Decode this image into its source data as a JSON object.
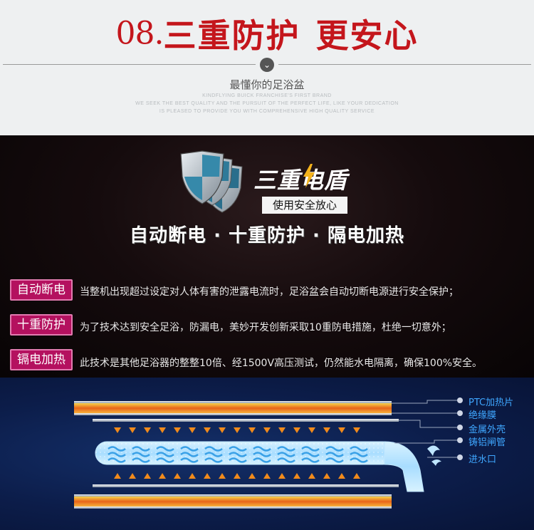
{
  "header": {
    "num": "08.",
    "title_a": "三重防护",
    "title_b": "更安心",
    "subtitle": "最懂你的足浴盆",
    "en_line1": "KINDFLYING Buick franchise's first brand",
    "en_line2": "We seek the best quality and the pursuit of the perfect life, like your dedication",
    "en_line3": "Is pleased to provide you with comprehensive high quality service"
  },
  "brand": {
    "title": "三重电盾",
    "sub": "使用安全放心",
    "slogan": "自动断电 · 十重防护 · 隔电加热"
  },
  "features": [
    {
      "tag": "自动断电",
      "desc": "当整机出现超过设定对人体有害的泄露电流时，足浴盆会自动切断电源进行安全保护；"
    },
    {
      "tag": "十重防护",
      "desc": "为了技术达到安全足浴，防漏电，美妙开发创新采取10重防电措施，杜绝一切意外；"
    },
    {
      "tag": "镉电加热",
      "desc": "此技术是其他足浴器的整整10倍、经1500V高压测试，仍然能水电隔离，确保100%安全。"
    }
  ],
  "legend": [
    "PTC加热片",
    "绝缘膜",
    "金属外壳",
    "铸铝闸管",
    "进水口"
  ],
  "colors": {
    "title_red": "#c4161c",
    "tag_magenta": "#b4115f",
    "legend_blue": "#3fa7ff",
    "heat_orange": "#f08a1c"
  }
}
